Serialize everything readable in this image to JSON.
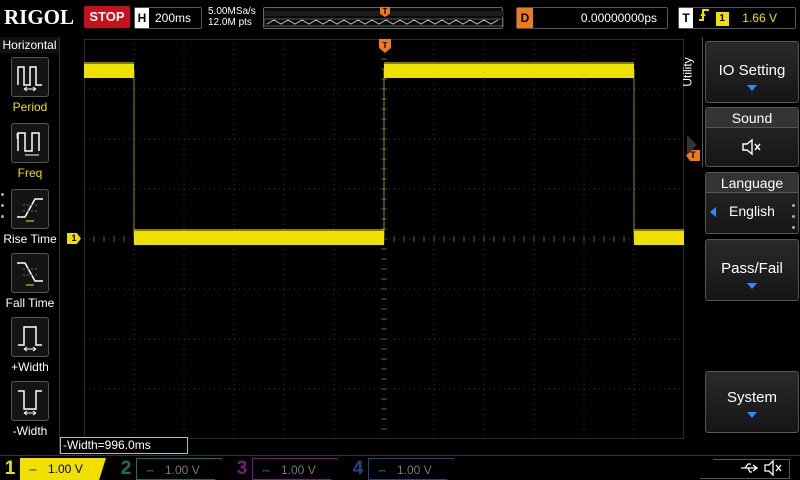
{
  "brand": {
    "logo": "RIGOL"
  },
  "run_state": {
    "label": "STOP",
    "color": "#c8101a"
  },
  "horizontal": {
    "chip": "H",
    "timebase": "200ms"
  },
  "acquisition": {
    "sample_rate": "5.00MSa/s",
    "memory_depth": "12.0M pts"
  },
  "trigger_overview": {
    "marker": "T"
  },
  "delay": {
    "chip": "D",
    "value": "0.00000000ps"
  },
  "trigger": {
    "chip": "T",
    "slope": "rising-edge",
    "source": "1",
    "level": "1.66 V"
  },
  "left_menu": {
    "title": "Horizontal",
    "items": [
      {
        "label": "Period",
        "icon": "period-icon"
      },
      {
        "label": "Freq",
        "icon": "frequency-icon"
      },
      {
        "label": "Rise Time",
        "icon": "rise-time-icon"
      },
      {
        "label": "Fall Time",
        "icon": "fall-time-icon"
      },
      {
        "label": "+Width",
        "icon": "positive-width-icon"
      },
      {
        "label": "-Width",
        "icon": "negative-width-icon"
      }
    ]
  },
  "measurement": {
    "readout": "-Width=996.0ms"
  },
  "right_menu": {
    "tab": "Utility",
    "items": [
      {
        "label": "IO Setting",
        "arrow": true
      },
      {
        "label": "Sound",
        "icon": "speaker-muted-icon"
      },
      {
        "label": "Language",
        "value": "English"
      },
      {
        "label": "Pass/Fail",
        "arrow": true
      },
      {
        "label": "System",
        "arrow": true
      }
    ]
  },
  "channels": [
    {
      "num": "1",
      "scale": "1.00 V",
      "color": "#f0e000",
      "active": true
    },
    {
      "num": "2",
      "scale": "1.00 V",
      "color": "#1fd0c8",
      "active": false
    },
    {
      "num": "3",
      "scale": "1.00 V",
      "color": "#e030e0",
      "active": false
    },
    {
      "num": "4",
      "scale": "1.00 V",
      "color": "#2a8cff",
      "active": false
    }
  ],
  "status_icons": [
    "usb-icon",
    "speaker-muted-icon"
  ],
  "waveform": {
    "channel": "1",
    "color": "#f0e000",
    "shape": "square",
    "segments": [
      {
        "level": "high",
        "from_div": 0.0,
        "to_div": 1.0
      },
      {
        "level": "low",
        "from_div": 1.0,
        "to_div": 6.0
      },
      {
        "level": "high",
        "from_div": 6.0,
        "to_div": 11.0
      },
      {
        "level": "low",
        "from_div": 11.0,
        "to_div": 12.0
      }
    ]
  }
}
